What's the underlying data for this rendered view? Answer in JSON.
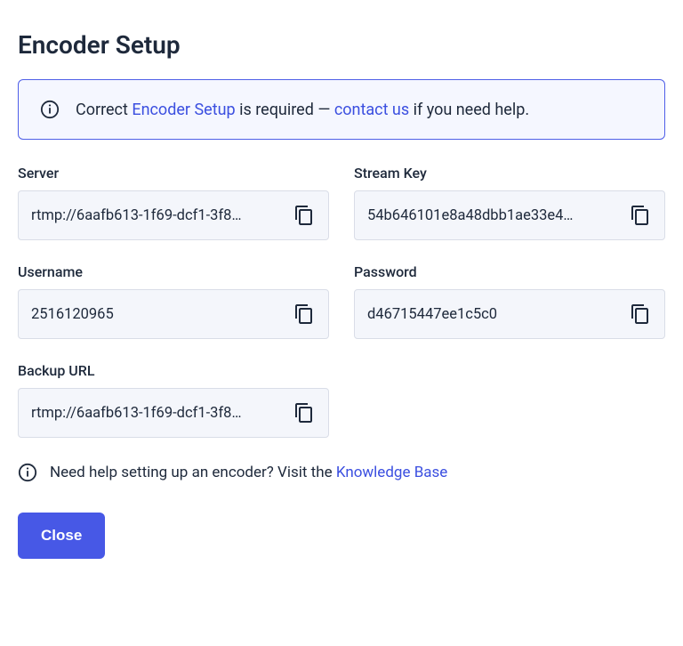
{
  "title": "Encoder Setup",
  "alert": {
    "pre": "Correct ",
    "link1": "Encoder Setup",
    "mid": " is required — ",
    "link2": "contact us",
    "post": " if you need help."
  },
  "fields": {
    "server": {
      "label": "Server",
      "value": "rtmp://6aafb613-1f69-dcf1-3f8…"
    },
    "stream_key": {
      "label": "Stream Key",
      "value": "54b646101e8a48dbb1ae33e4…"
    },
    "username": {
      "label": "Username",
      "value": "2516120965"
    },
    "password": {
      "label": "Password",
      "value": "d46715447ee1c5c0"
    },
    "backup_url": {
      "label": "Backup URL",
      "value": "rtmp://6aafb613-1f69-dcf1-3f8…"
    }
  },
  "help": {
    "pre": "Need help setting up an encoder? Visit the ",
    "link": "Knowledge Base"
  },
  "close_label": "Close"
}
